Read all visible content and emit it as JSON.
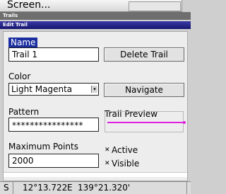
{
  "screen_tab": {
    "label": "Screen..."
  },
  "titlebar": {
    "trails": "Trails",
    "edit_trail": "Edit Trail"
  },
  "form": {
    "name": {
      "label": "Name",
      "value": "Trail 1"
    },
    "color": {
      "label": "Color",
      "value": "Light Magenta"
    },
    "pattern": {
      "label": "Pattern",
      "value": "****************"
    },
    "max_points": {
      "label": "Maximum Points",
      "value": "2000"
    },
    "trail_preview": {
      "label": "Trail Preview",
      "line_color": "#e020e0"
    },
    "active": {
      "label": "Active",
      "checked": true
    },
    "visible": {
      "label": "Visible",
      "checked": true
    }
  },
  "buttons": {
    "delete_trail": "Delete Trail",
    "navigate": "Navigate"
  },
  "status": {
    "lat_hemisphere": "S",
    "latitude": "12°13.722'",
    "lon_hemisphere": "E",
    "longitude": "139°21.320'"
  },
  "colors": {
    "selection": "#1c2fa0",
    "titlebar": "#16166e",
    "panel": "#ededed"
  },
  "icons": {
    "checkmark": "x-check-icon",
    "dropdown": "chevron-down-icon"
  }
}
